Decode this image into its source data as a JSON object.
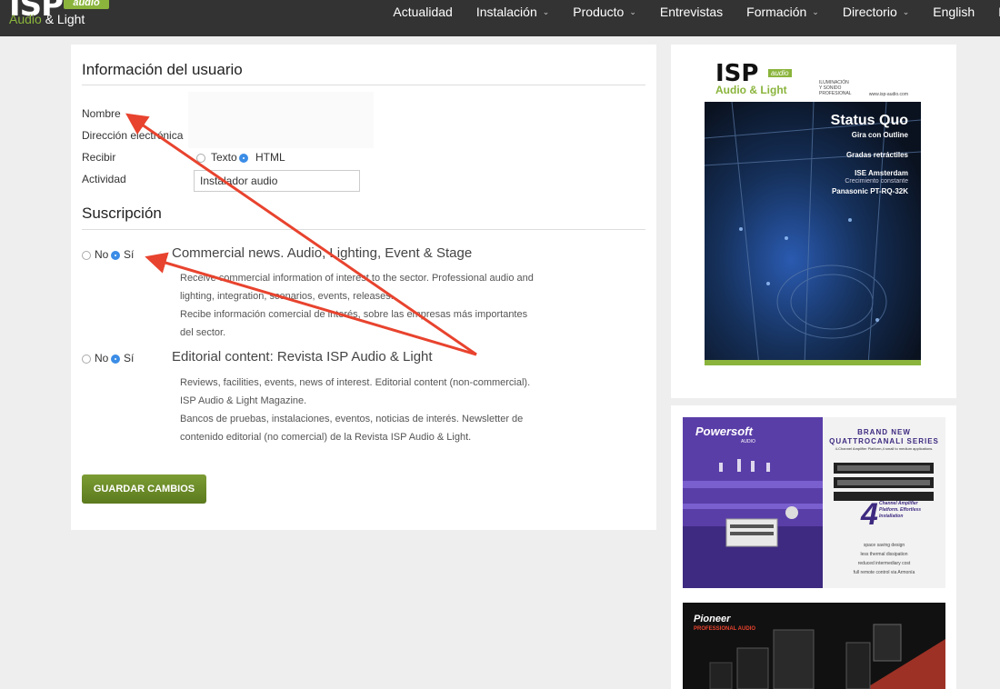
{
  "nav": {
    "logo_text": "ISP",
    "logo_tag": "audio",
    "logo_sub_a": "Audio",
    "logo_sub_b": "& Light",
    "items": [
      {
        "label": "Actualidad",
        "dropdown": false
      },
      {
        "label": "Instalación",
        "dropdown": true
      },
      {
        "label": "Producto",
        "dropdown": true
      },
      {
        "label": "Entrevistas",
        "dropdown": false
      },
      {
        "label": "Formación",
        "dropdown": true
      },
      {
        "label": "Directorio",
        "dropdown": true
      },
      {
        "label": "English",
        "dropdown": false
      },
      {
        "label": "L",
        "dropdown": false
      }
    ]
  },
  "user_info": {
    "title": "Información del usuario",
    "name_label": "Nombre",
    "email_label": "Dirección electrónica",
    "receive_label": "Recibir",
    "format_text": "Texto",
    "format_html": "HTML",
    "format_selected": "HTML",
    "activity_label": "Actividad",
    "activity_value": "Instalador audio"
  },
  "subscription": {
    "title": "Suscripción",
    "no_label": "No",
    "yes_label": "Sí",
    "items": [
      {
        "title": "Commercial news. Audio, Lighting, Event & Stage",
        "selected": "yes",
        "lines": [
          "Receive commercial information of interest to the sector. Professional audio and",
          "lighting, integration, scenarios, events, releases.",
          "Recibe información comercial de interés, sobre las empresas más importantes",
          "del sector."
        ]
      },
      {
        "title": "Editorial content: Revista ISP Audio & Light",
        "selected": "yes",
        "lines": [
          "Reviews, facilities, events, news of interest. Editorial content (non-commercial).",
          "ISP Audio & Light Magazine.",
          "Bancos de pruebas, instalaciones, eventos, noticias de interés. Newsletter de",
          "contenido editorial (no comercial) de la Revista ISP Audio & Light."
        ]
      }
    ]
  },
  "save_button": "GUARDAR CAMBIOS",
  "sidebar": {
    "cover": {
      "brand": "ISP",
      "brand_sub": "Audio & Light",
      "brand_tag": "audio",
      "small_1": "ILUMINACIÓN",
      "small_2": "Y SONIDO",
      "small_3": "PROFESIONAL",
      "url": "www.isp-audio.com",
      "headline": "Status Quo",
      "headline_sub": "Gira con Outline",
      "item_1": "Gradas retráctiles",
      "item_2": "ISE Amsterdam",
      "item_2_sub": "Crecimiento constante",
      "item_3": "Panasonic PT-RQ-32K"
    },
    "ad1": {
      "brand": "Powersoft",
      "brand_sub": "AUDIO",
      "title_1": "BRAND NEW",
      "title_2": "QUATTROCANALI SERIES",
      "subtitle": "4-Channel Amplifier Platform,4 small to medium applications.",
      "big_number": "4",
      "num_text": "Channel Amplifier Platform. Effortless Installation",
      "features": [
        "space saving design",
        "less thermal dissipation",
        "reduced intermediary cost",
        "full remote control via Armonía"
      ]
    },
    "ad2": {
      "brand": "Pioneer",
      "brand_sub": "PROFESSIONAL AUDIO"
    }
  },
  "colors": {
    "nav_bg": "#333333",
    "accent_green": "#8ab43c",
    "button_green": "#6d8b2a",
    "radio_blue": "#3b8de6",
    "arrow_red": "#e8432e"
  }
}
